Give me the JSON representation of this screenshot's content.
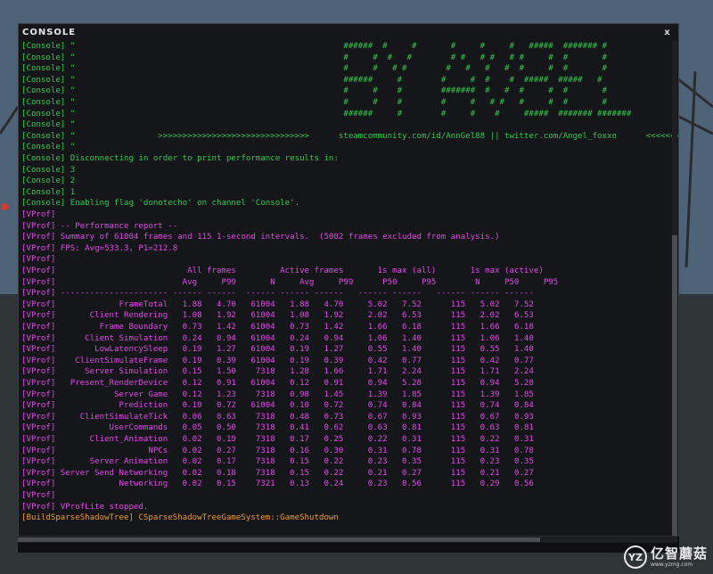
{
  "window": {
    "title": "CONSOLE",
    "close_label": "x"
  },
  "colors": {
    "console_green": "#34c94e",
    "vprof_magenta": "#e148e6",
    "shadow_orange": "#ec9a3a",
    "background": "#141619"
  },
  "lines": [
    {
      "color": "green",
      "text": "[Console] \"                                                       ######  #     #       #     #     #   #####  ####### #"
    },
    {
      "color": "green",
      "text": "[Console] \"                                                       #     #  #   #        # #   # #   # #     #  #       #"
    },
    {
      "color": "green",
      "text": "[Console] \"                                                       #     #   # #        #   #   #   #  #     #  #       #"
    },
    {
      "color": "green",
      "text": "[Console] \"                                                       ######     #        #     #  #    #  #####  #####   #"
    },
    {
      "color": "green",
      "text": "[Console] \"                                                       #     #    #        #######  #   #  #     #  #       #"
    },
    {
      "color": "green",
      "text": "[Console] \"                                                       #     #    #        #     #   # #   #     #  #       #"
    },
    {
      "color": "green",
      "text": "[Console] \"                                                       ######     #        #     #    #     #####  ####### #######"
    },
    {
      "color": "green",
      "text": "[Console] \""
    },
    {
      "color": "green",
      "text": "[Console] \"                 >>>>>>>>>>>>>>>>>>>>>>>>>>>>>>>      steamcommunity.com/id/AnnGel88 || twitter.com/Angel_foxxo      <<<<<<<<<<<<<<<<<<<<<<<<<<<<<<<"
    },
    {
      "color": "green",
      "text": "[Console] \""
    },
    {
      "color": "green",
      "text": "[Console] Disconnecting in order to print performance results in:"
    },
    {
      "color": "green",
      "text": "[Console] 3"
    },
    {
      "color": "green",
      "text": "[Console] 2"
    },
    {
      "color": "green",
      "text": "[Console] 1"
    },
    {
      "color": "green",
      "text": "[Console] Enabling flag 'donotecho' on channel 'Console'."
    },
    {
      "color": "magenta",
      "text": "[VProf]"
    },
    {
      "color": "magenta",
      "text": "[VProf] -- Performance report --"
    },
    {
      "color": "magenta",
      "text": "[VProf] Summary of 61004 frames and 115 1-second intervals.  (5002 frames excluded from analysis.)"
    },
    {
      "color": "magenta",
      "text": "[VProf] FPS: Avg=533.3, P1=212.8"
    },
    {
      "color": "magenta",
      "text": "[VProf]"
    },
    {
      "color": "magenta",
      "text": "[VProf]                           All frames         Active frames       1s max (all)       1s max (active)"
    },
    {
      "color": "magenta",
      "text": "[VProf]                          Avg     P99       N     Avg     P99      P50     P95        N     P50     P95"
    },
    {
      "color": "magenta",
      "text": "[VProf] ---------------------- ------ ------  ------ ------ ------   ------ ------   ------ ------ ------"
    },
    {
      "color": "magenta",
      "text": "[VProf]             FrameTotal   1.88   4.70   61004   1.88   4.70     5.02   7.52      115   5.02   7.52"
    },
    {
      "color": "magenta",
      "text": "[VProf]       Client Rendering   1.08   1.92   61004   1.08   1.92     2.02   6.53      115   2.02   6.53"
    },
    {
      "color": "magenta",
      "text": "[VProf]         Frame Boundary   0.73   1.42   61004   0.73   1.42     1.66   6.18      115   1.66   6.18"
    },
    {
      "color": "magenta",
      "text": "[VProf]      Client Simulation   0.24   0.94   61004   0.24   0.94     1.06   1.40      115   1.06   1.40"
    },
    {
      "color": "magenta",
      "text": "[VProf]        LowLatencySleep   0.19   1.27   61004   0.19   1.27     0.55   1.40      115   0.55   1.40"
    },
    {
      "color": "magenta",
      "text": "[VProf]    ClientSimulateFrame   0.19   0.39   61004   0.19   0.39     0.42   0.77      115   0.42   0.77"
    },
    {
      "color": "magenta",
      "text": "[VProf]      Server Simulation   0.15   1.50    7318   1.28   1.66     1.71   2.24      115   1.71   2.24"
    },
    {
      "color": "magenta",
      "text": "[VProf]   Present_RenderDevice   0.12   0.91   61004   0.12   0.91     0.94   5.28      115   0.94   5.28"
    },
    {
      "color": "magenta",
      "text": "[VProf]            Server Game   0.12   1.23    7318   0.98   1.45     1.39   1.85      115   1.39   1.85"
    },
    {
      "color": "magenta",
      "text": "[VProf]             Prediction   0.10   0.72   61004   0.10   0.72     0.74   0.84      115   0.74   0.84"
    },
    {
      "color": "magenta",
      "text": "[VProf]     ClientSimulateTick   0.06   0.63    7318   0.48   0.73     0.67   0.93      115   0.67   0.93"
    },
    {
      "color": "magenta",
      "text": "[VProf]           UserCommands   0.05   0.50    7318   0.41   0.62     0.63   0.81      115   0.63   0.81"
    },
    {
      "color": "magenta",
      "text": "[VProf]       Client_Animation   0.02   0.19    7318   0.17   0.25     0.22   0.31      115   0.22   0.31"
    },
    {
      "color": "magenta",
      "text": "[VProf]                   NPCs   0.02   0.27    7318   0.16   0.30     0.31   0.78      115   0.31   0.78"
    },
    {
      "color": "magenta",
      "text": "[VProf]       Server Animation   0.02   0.17    7318   0.15   0.22     0.23   0.35      115   0.23   0.35"
    },
    {
      "color": "magenta",
      "text": "[VProf] Server Send Networking   0.02   0.18    7318   0.15   0.22     0.21   0.27      115   0.21   0.27"
    },
    {
      "color": "magenta",
      "text": "[VProf]             Networking   0.02   0.15    7321   0.13   0.24     0.23   0.56      115   0.29   0.56"
    },
    {
      "color": "magenta",
      "text": "[VProf]"
    },
    {
      "color": "magenta",
      "text": "[VProf] VProfLite stopped."
    },
    {
      "color": "orange",
      "text": "[BuildSparseShadowTree] CSparseShadowTreeGameSystem::GameShutdown"
    }
  ],
  "watermark": {
    "logo_text": "YZ",
    "main": "亿智蘑菇",
    "sub": "www.yzmg.com"
  }
}
